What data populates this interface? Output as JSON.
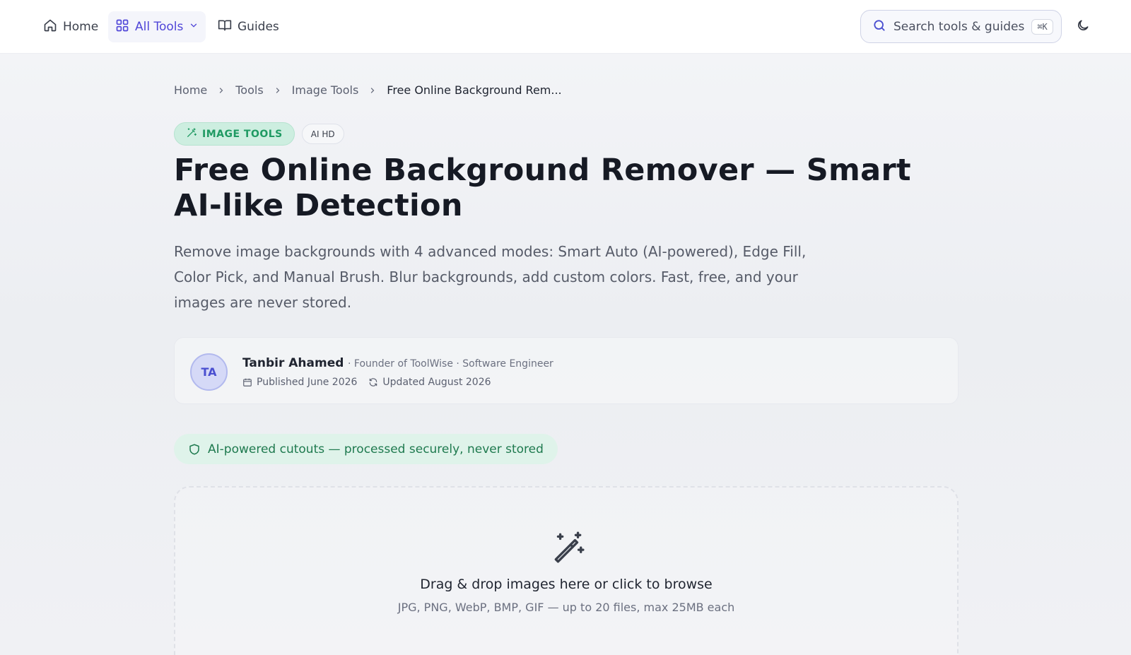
{
  "nav": {
    "home_label": "Home",
    "all_tools_label": "All Tools",
    "guides_label": "Guides",
    "search_placeholder": "Search tools & guides",
    "search_shortcut": "⌘K"
  },
  "breadcrumb": {
    "items": [
      "Home",
      "Tools",
      "Image Tools"
    ],
    "current": "Free Online Background Rem..."
  },
  "badges": {
    "category": "IMAGE TOOLS",
    "tag": "AI HD"
  },
  "page": {
    "title": "Free Online Background Remover — Smart AI-like Detection",
    "description": "Remove image backgrounds with 4 advanced modes: Smart Auto (AI-powered), Edge Fill, Color Pick, and Manual Brush. Blur backgrounds, add custom colors. Fast, free, and your images are never stored."
  },
  "author": {
    "initials": "TA",
    "name": "Tanbir Ahamed",
    "role": "· Founder of ToolWise · Software Engineer",
    "published": "Published June 2026",
    "updated": "Updated August 2026"
  },
  "notice": {
    "secure_text": "AI-powered cutouts — processed securely, never stored"
  },
  "dropzone": {
    "title": "Drag & drop images here or click to browse",
    "subtitle": "JPG, PNG, WebP, BMP, GIF — up to 20 files, max 25MB each"
  },
  "colors": {
    "accent": "#5046d8",
    "success": "#1f9a63"
  }
}
